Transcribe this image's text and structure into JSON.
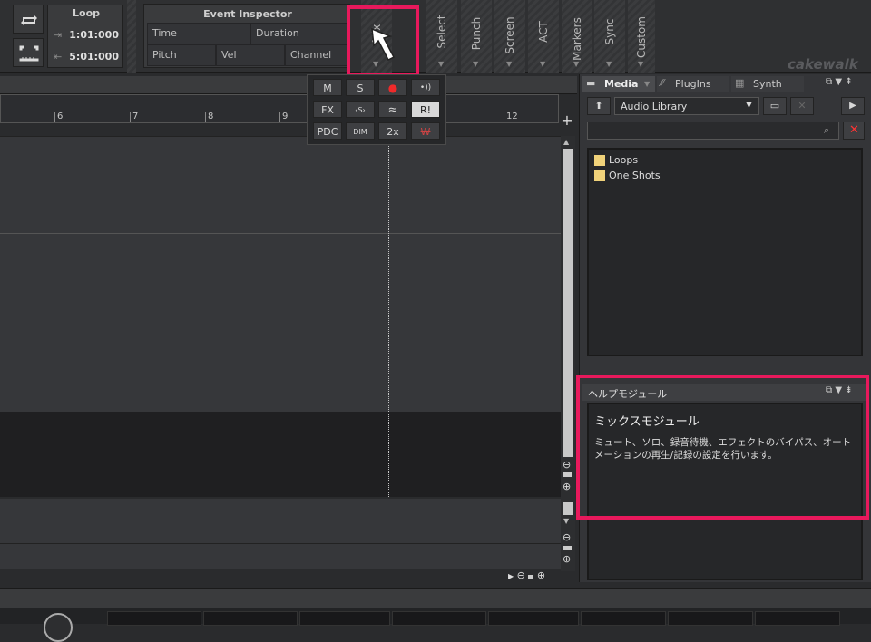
{
  "loop_module": {
    "title": "Loop",
    "start": "1:01:000",
    "end": "5:01:000"
  },
  "event_inspector": {
    "title": "Event Inspector",
    "fields": [
      "Time",
      "Duration",
      "Pitch",
      "Vel",
      "Channel"
    ]
  },
  "toolbar_strips": [
    "Mix",
    "Select",
    "Punch",
    "Screen",
    "ACT",
    "Markers",
    "Sync",
    "Custom"
  ],
  "brand": "cakewalk",
  "mix_popup": {
    "row1": [
      "M",
      "S",
      "●",
      "•))"
    ],
    "row2": [
      "FX",
      "‹S›",
      "≈",
      "R!"
    ],
    "row3": [
      "PDC",
      "DIM",
      "2x",
      "W"
    ]
  },
  "ruler": {
    "ticks": [
      "6",
      "7",
      "8",
      "9",
      "12"
    ]
  },
  "browser": {
    "tabs": [
      "Media",
      "PlugIns",
      "Synth"
    ],
    "library": "Audio Library",
    "items": [
      "Loops",
      "One Shots"
    ]
  },
  "help": {
    "title": "ヘルプモジュール",
    "heading": "ミックスモジュール",
    "body_line1": "ミュート、ソロ、録音待機、エフェクトのバイパス、オート",
    "body_line2": "メーションの再生/記録の設定を行います。"
  },
  "colors": {
    "accent": "#e8195c",
    "panel": "#3a3b3d",
    "dark": "#1c1c1e"
  }
}
